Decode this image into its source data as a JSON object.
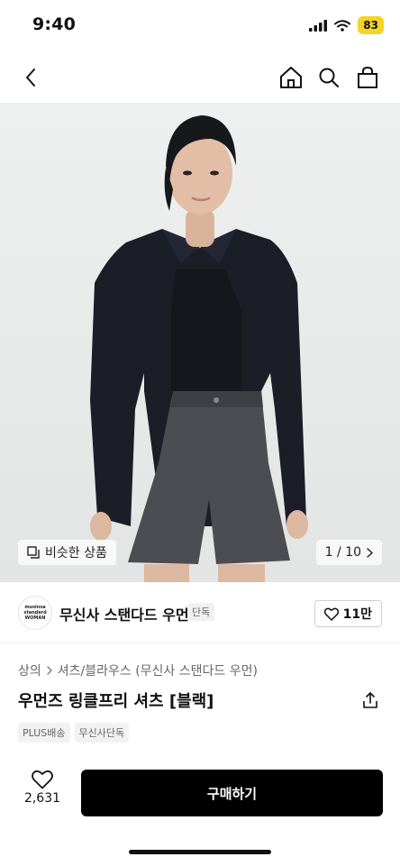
{
  "status_bar": {
    "time": "9:40",
    "battery": "83"
  },
  "nav": {
    "icons": [
      "back-arrow-icon",
      "home-icon",
      "search-icon",
      "shopping-bag-icon"
    ]
  },
  "hero": {
    "similar_label": "비슷한 상품",
    "counter": "1 / 10"
  },
  "brand": {
    "logo_lines": [
      "musinsa",
      "standard",
      "WOMAN"
    ],
    "name": "무신사 스탠다드 우먼",
    "tag": "단독",
    "likes": "11만"
  },
  "breadcrumb": {
    "category": "상의",
    "subcategory": "셔츠/블라우스 (무신사 스탠다드 우먼)"
  },
  "product": {
    "title": "우먼즈 링클프리 셔츠 [블랙]",
    "tags": [
      "PLUS배송",
      "무신사단독"
    ]
  },
  "bottom": {
    "wishlist_count": "2,631",
    "buy_label": "구매하기"
  }
}
